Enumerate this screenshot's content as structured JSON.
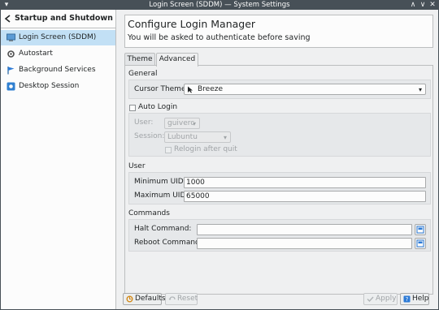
{
  "window": {
    "title": "Login Screen (SDDM)  — System Settings",
    "controls": {
      "shade": "▾",
      "minimize": "∧",
      "maximize": "∨",
      "close": "✕"
    }
  },
  "sidebar": {
    "header_label": "Startup and Shutdown",
    "items": [
      {
        "label": "Login Screen (SDDM)",
        "icon": "login-screen-icon",
        "selected": true
      },
      {
        "label": "Autostart",
        "icon": "gear-icon",
        "selected": false
      },
      {
        "label": "Background Services",
        "icon": "flag-icon",
        "selected": false
      },
      {
        "label": "Desktop Session",
        "icon": "desktop-icon",
        "selected": false
      }
    ]
  },
  "header": {
    "title": "Configure Login Manager",
    "subtitle": "You will be asked to authenticate before saving"
  },
  "tabs": [
    {
      "label": "Theme",
      "active": false
    },
    {
      "label": "Advanced",
      "active": true
    }
  ],
  "general": {
    "title": "General",
    "cursor_theme_label": "Cursor Theme:",
    "cursor_theme_value": "Breeze"
  },
  "autologin": {
    "label": "Auto Login",
    "checked": false,
    "user_label": "User:",
    "user_value": "guiverc",
    "session_label": "Session:",
    "session_value": "Lubuntu",
    "relogin_label": "Relogin after quit"
  },
  "user": {
    "title": "User",
    "min_uid_label": "Minimum UID:",
    "min_uid_value": "1000",
    "max_uid_label": "Maximum UID:",
    "max_uid_value": "65000"
  },
  "commands": {
    "title": "Commands",
    "halt_label": "Halt Command:",
    "halt_value": "",
    "reboot_label": "Reboot Command:",
    "reboot_value": ""
  },
  "buttons": {
    "defaults": "Defaults",
    "reset": "Reset",
    "apply": "Apply",
    "help": "Help"
  },
  "colors": {
    "titlebar": "#475057",
    "selection": "#c2e0f5",
    "window_bg": "#eff0f1",
    "view_bg": "#fcfcfc"
  }
}
